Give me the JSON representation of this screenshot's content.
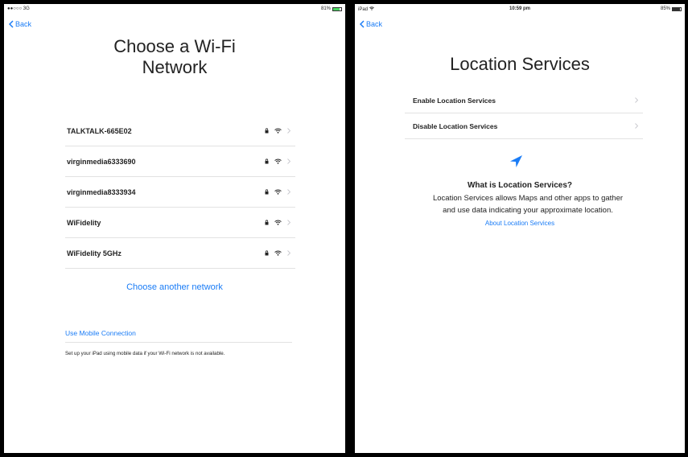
{
  "left": {
    "status": {
      "carrier": "●●○○○ 3G",
      "battery": "81%"
    },
    "back_label": "Back",
    "title_line1": "Choose a Wi-Fi",
    "title_line2": "Network",
    "networks": [
      {
        "name": "TALKTALK-665E02"
      },
      {
        "name": "virginmedia6333690"
      },
      {
        "name": "virginmedia8333934"
      },
      {
        "name": "WiFidelity"
      },
      {
        "name": "WiFidelity 5GHz"
      }
    ],
    "choose_another": "Choose another network",
    "mobile_link": "Use Mobile Connection",
    "mobile_desc": "Set up your iPad using mobile data if your Wi-Fi network is not available."
  },
  "right": {
    "status": {
      "device": "iPad",
      "time": "10:59 pm",
      "battery": "85%"
    },
    "back_label": "Back",
    "title": "Location Services",
    "options": [
      {
        "label": "Enable Location Services"
      },
      {
        "label": "Disable Location Services"
      }
    ],
    "icon": "location-arrow-icon",
    "what_title": "What is Location Services?",
    "description_line1": "Location Services allows Maps and other apps to gather",
    "description_line2": "and use data indicating your approximate location.",
    "about_link": "About Location Services"
  },
  "colors": {
    "accent": "#1a7cf6",
    "text": "#222222",
    "separator": "#e2e2e2"
  }
}
